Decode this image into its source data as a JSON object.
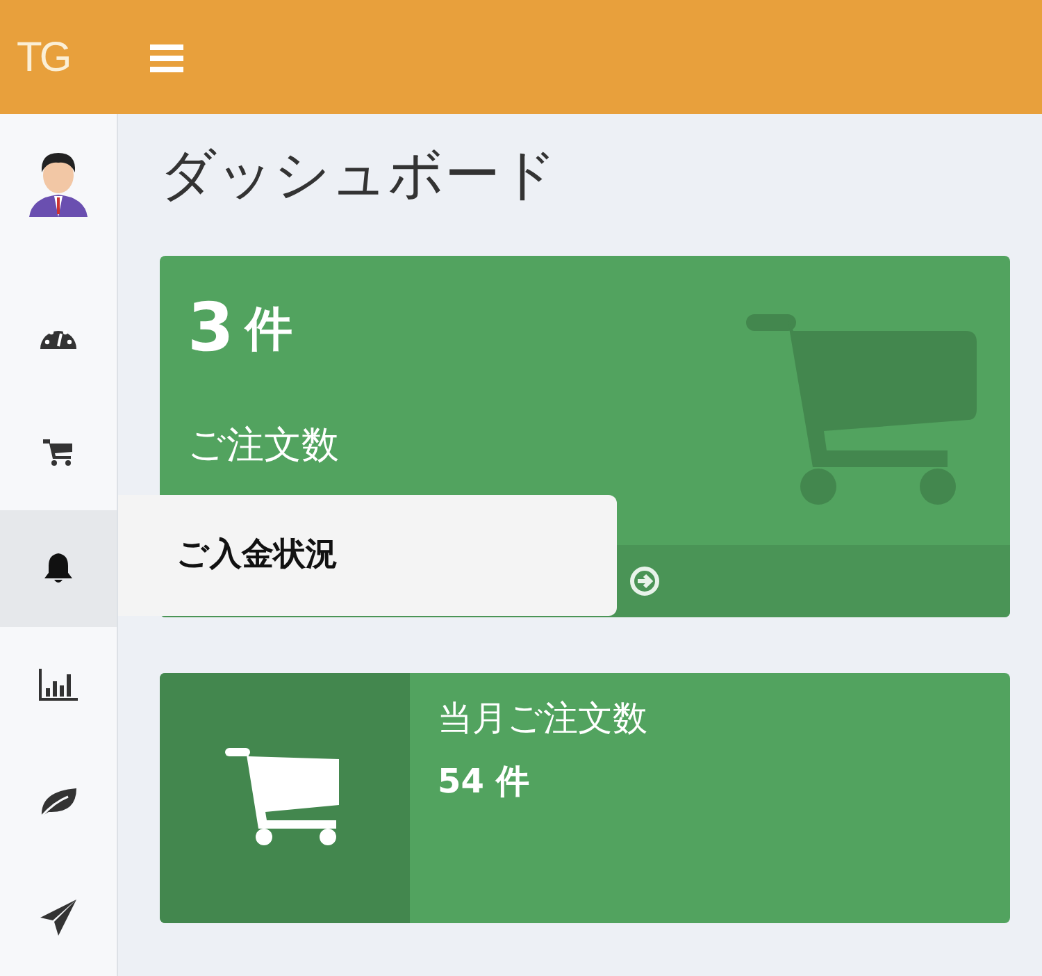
{
  "header": {
    "brand": "TG"
  },
  "sidebar": {
    "items": [
      {
        "kind": "avatar",
        "selected": false
      },
      {
        "kind": "gauge",
        "selected": false
      },
      {
        "kind": "cart",
        "selected": false
      },
      {
        "kind": "bell",
        "selected": true
      },
      {
        "kind": "chart",
        "selected": false
      },
      {
        "kind": "leaf",
        "selected": false
      },
      {
        "kind": "send",
        "selected": false
      }
    ]
  },
  "flyout": {
    "label": "ご入金状況"
  },
  "page_title": "ダッシュボード",
  "order_card": {
    "value": "3",
    "unit": "件",
    "label": "ご注文数"
  },
  "monthly_card": {
    "label": "当月ご注文数",
    "value": "54 件"
  }
}
